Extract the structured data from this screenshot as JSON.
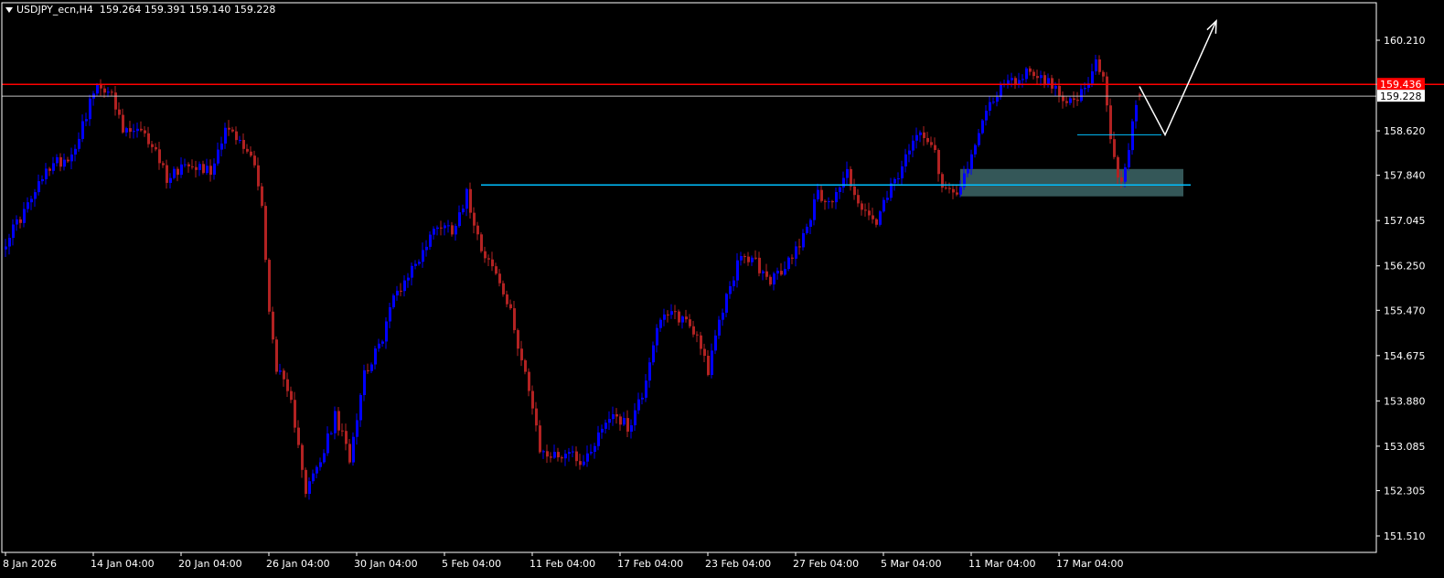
{
  "header": {
    "symbol": "USDJPY_ecn,H4",
    "ohlc": "159.264 159.391 159.140 159.228"
  },
  "colors": {
    "background": "#000000",
    "frame": "#ffffff",
    "bull": "#0000ff",
    "bear": "#b22222",
    "resistance": "#ff0000",
    "support": "#00bfff",
    "zone": "#5f9ea0",
    "current_price_line": "#c0c0c0",
    "projection": "#ffffff"
  },
  "chart_data": {
    "type": "candlestick",
    "symbol": "USDJPY_ecn",
    "timeframe": "H4",
    "y_ticks": [
      "160.210",
      "158.620",
      "157.840",
      "157.045",
      "156.250",
      "155.470",
      "154.675",
      "153.880",
      "153.085",
      "152.305",
      "151.510"
    ],
    "y_tick_values": [
      160.21,
      158.62,
      157.84,
      157.045,
      156.25,
      155.47,
      154.675,
      153.88,
      153.085,
      152.305,
      151.51
    ],
    "ylim": [
      151.25,
      160.95
    ],
    "x_ticks": [
      "8 Jan 2026",
      "14 Jan 04:00",
      "20 Jan 04:00",
      "26 Jan 04:00",
      "30 Jan 04:00",
      "5 Feb 04:00",
      "11 Feb 04:00",
      "17 Feb 04:00",
      "23 Feb 04:00",
      "27 Feb 04:00",
      "5 Mar 04:00",
      "11 Mar 04:00",
      "17 Mar 04:00"
    ],
    "x_tick_index": [
      0,
      24,
      48,
      72,
      96,
      120,
      144,
      168,
      192,
      216,
      240,
      264,
      288
    ],
    "total_slots": 375,
    "path_points": [
      [
        0,
        156.7
      ],
      [
        6,
        157.3
      ],
      [
        12,
        158.0
      ],
      [
        18,
        158.2
      ],
      [
        24,
        159.3
      ],
      [
        28,
        159.4
      ],
      [
        32,
        158.6
      ],
      [
        36,
        158.6
      ],
      [
        40,
        158.4
      ],
      [
        44,
        157.8
      ],
      [
        50,
        158.1
      ],
      [
        56,
        157.9
      ],
      [
        60,
        158.7
      ],
      [
        64,
        158.4
      ],
      [
        68,
        158.1
      ],
      [
        70,
        157.3
      ],
      [
        72,
        155.4
      ],
      [
        74,
        154.5
      ],
      [
        78,
        153.8
      ],
      [
        80,
        153.2
      ],
      [
        82,
        152.3
      ],
      [
        86,
        152.8
      ],
      [
        90,
        153.6
      ],
      [
        94,
        152.9
      ],
      [
        98,
        154.4
      ],
      [
        102,
        154.8
      ],
      [
        106,
        155.7
      ],
      [
        110,
        156.1
      ],
      [
        114,
        156.5
      ],
      [
        118,
        157.0
      ],
      [
        122,
        156.9
      ],
      [
        126,
        157.5
      ],
      [
        130,
        156.6
      ],
      [
        134,
        156.1
      ],
      [
        138,
        155.4
      ],
      [
        142,
        154.4
      ],
      [
        146,
        153.0
      ],
      [
        150,
        152.9
      ],
      [
        154,
        153.0
      ],
      [
        158,
        152.8
      ],
      [
        162,
        153.3
      ],
      [
        166,
        153.7
      ],
      [
        170,
        153.4
      ],
      [
        174,
        154.0
      ],
      [
        178,
        155.2
      ],
      [
        182,
        155.4
      ],
      [
        186,
        155.3
      ],
      [
        190,
        154.9
      ],
      [
        192,
        154.4
      ],
      [
        196,
        155.5
      ],
      [
        200,
        156.3
      ],
      [
        204,
        156.4
      ],
      [
        208,
        156.0
      ],
      [
        212,
        156.1
      ],
      [
        218,
        156.8
      ],
      [
        222,
        157.5
      ],
      [
        226,
        157.4
      ],
      [
        230,
        157.9
      ],
      [
        234,
        157.2
      ],
      [
        238,
        157.0
      ],
      [
        242,
        157.6
      ],
      [
        246,
        158.1
      ],
      [
        250,
        158.7
      ],
      [
        254,
        158.3
      ],
      [
        256,
        157.6
      ],
      [
        260,
        157.6
      ],
      [
        264,
        158.1
      ],
      [
        268,
        159.0
      ],
      [
        272,
        159.4
      ],
      [
        276,
        159.5
      ],
      [
        280,
        159.7
      ],
      [
        284,
        159.5
      ],
      [
        288,
        159.3
      ],
      [
        292,
        159.1
      ],
      [
        296,
        159.4
      ],
      [
        298,
        159.8
      ],
      [
        300,
        159.5
      ],
      [
        302,
        158.5
      ],
      [
        304,
        157.7
      ],
      [
        306,
        157.9
      ],
      [
        308,
        158.7
      ],
      [
        310,
        159.228
      ]
    ],
    "last_candle": {
      "open": 159.264,
      "high": 159.391,
      "low": 159.14,
      "close": 159.228
    },
    "resistance_level": {
      "price": 159.436,
      "label": "159.436",
      "from_index": 0,
      "to_index": 375
    },
    "support_level": {
      "price": 157.67,
      "from_index": 130,
      "to_index": 324
    },
    "demand_zone": {
      "from_index": 261,
      "to_index": 322,
      "low": 157.47,
      "high": 157.95
    },
    "current_price": {
      "price": 159.228,
      "label": "159.228"
    },
    "pullback_level": {
      "price": 158.55,
      "from_index": 293,
      "to_index": 316
    },
    "projection": [
      [
        310,
        159.4
      ],
      [
        317,
        158.55
      ],
      [
        331,
        160.55
      ]
    ],
    "grid": false
  }
}
